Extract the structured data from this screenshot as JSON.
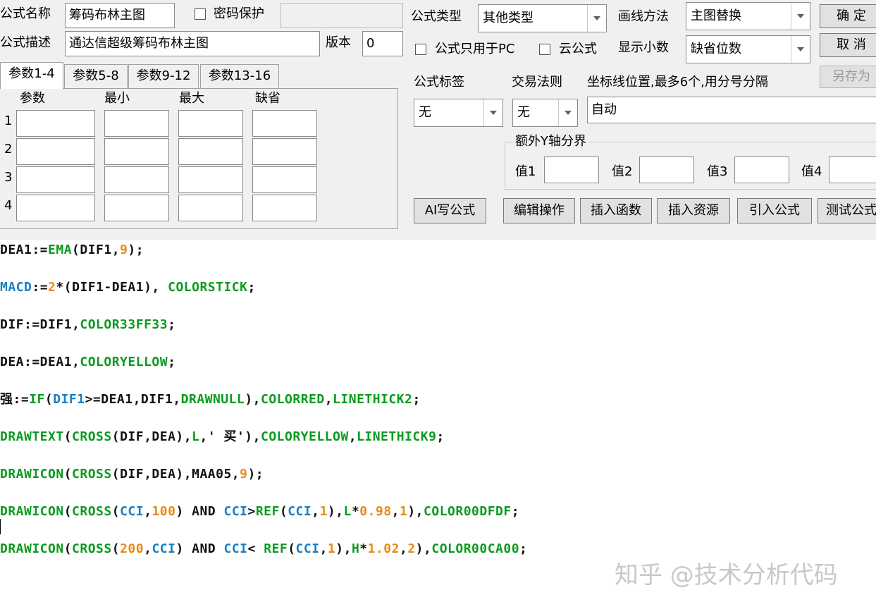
{
  "header": {
    "formula_name_label": "公式名称",
    "formula_name_value": "筹码布林主图",
    "password_label": "密码保护",
    "description_label": "公式描述",
    "description_value": "通达信超级筹码布林主图",
    "version_label": "版本",
    "version_value": "0",
    "formula_type_label": "公式类型",
    "formula_type_value": "其他类型",
    "draw_method_label": "画线方法",
    "draw_method_value": "主图替换",
    "pc_only_label": "公式只用于PC",
    "cloud_label": "云公式",
    "decimals_label": "显示小数",
    "decimals_value": "缺省位数"
  },
  "buttons": {
    "ok": "确 定",
    "cancel": "取 消",
    "save_as": "另存为",
    "ai_write": "AI写公式",
    "edit_ops": "编辑操作",
    "insert_func": "插入函数",
    "insert_res": "插入资源",
    "import_formula": "引入公式",
    "test_formula": "测试公式"
  },
  "tabs": [
    "参数1-4",
    "参数5-8",
    "参数9-12",
    "参数13-16"
  ],
  "params": {
    "headers": [
      "参数",
      "最小",
      "最大",
      "缺省"
    ],
    "rows": [
      "1",
      "2",
      "3",
      "4"
    ]
  },
  "right": {
    "tag_label": "公式标签",
    "tag_value": "无",
    "trade_label": "交易法则",
    "trade_value": "无",
    "axis_label": "坐标线位置,最多6个,用分号分隔",
    "axis_value": "自动",
    "extra_y_label": "额外Y轴分界",
    "v1": "值1",
    "v2": "值2",
    "v3": "值3",
    "v4": "值4"
  },
  "code_lines": [
    [
      [
        "DEA1:=",
        "k-d"
      ],
      [
        "EMA",
        "k-g"
      ],
      [
        "(DIF1,",
        "k-d"
      ],
      [
        "9",
        "k-o"
      ],
      [
        ");",
        "k-d"
      ]
    ],
    [
      [
        "MACD",
        "k-b"
      ],
      [
        ":=",
        "k-d"
      ],
      [
        "2",
        "k-o"
      ],
      [
        "*(DIF1-DEA1), ",
        "k-d"
      ],
      [
        "COLORSTICK",
        "k-g"
      ],
      [
        ";",
        "k-d"
      ]
    ],
    [
      [
        "DIF:=DIF1,",
        "k-d"
      ],
      [
        "COLOR33FF33",
        "k-g"
      ],
      [
        ";",
        "k-d"
      ]
    ],
    [
      [
        "DEA:=DEA1,",
        "k-d"
      ],
      [
        "COLORYELLOW",
        "k-g"
      ],
      [
        ";",
        "k-d"
      ]
    ],
    [
      [
        "强:=",
        "k-d"
      ],
      [
        "IF",
        "k-g"
      ],
      [
        "(",
        "k-d"
      ],
      [
        "DIF1",
        "k-b"
      ],
      [
        ">=DEA1,DIF1,",
        "k-d"
      ],
      [
        "DRAWNULL",
        "k-g"
      ],
      [
        "),",
        "k-d"
      ],
      [
        "COLORRED",
        "k-g"
      ],
      [
        ",",
        "k-d"
      ],
      [
        "LINETHICK2",
        "k-g"
      ],
      [
        ";",
        "k-d"
      ]
    ],
    [
      [
        "DRAWTEXT",
        "k-g"
      ],
      [
        "(",
        "k-d"
      ],
      [
        "CROSS",
        "k-g"
      ],
      [
        "(DIF,DEA),",
        "k-d"
      ],
      [
        "L",
        "k-g"
      ],
      [
        ",' 买'),",
        "k-d"
      ],
      [
        "COLORYELLOW",
        "k-g"
      ],
      [
        ",",
        "k-d"
      ],
      [
        "LINETHICK9",
        "k-g"
      ],
      [
        ";",
        "k-d"
      ]
    ],
    [
      [
        "DRAWICON",
        "k-g"
      ],
      [
        "(",
        "k-d"
      ],
      [
        "CROSS",
        "k-g"
      ],
      [
        "(DIF,DEA),MAA05,",
        "k-d"
      ],
      [
        "9",
        "k-o"
      ],
      [
        ");",
        "k-d"
      ]
    ],
    [
      [
        "DRAWICON",
        "k-g"
      ],
      [
        "(",
        "k-d"
      ],
      [
        "CROSS",
        "k-g"
      ],
      [
        "(",
        "k-d"
      ],
      [
        "CCI",
        "k-b"
      ],
      [
        ",",
        "k-d"
      ],
      [
        "100",
        "k-o"
      ],
      [
        ") AND ",
        "k-d"
      ],
      [
        "CCI",
        "k-b"
      ],
      [
        ">",
        "k-d"
      ],
      [
        "REF",
        "k-g"
      ],
      [
        "(",
        "k-d"
      ],
      [
        "CCI",
        "k-b"
      ],
      [
        ",",
        "k-d"
      ],
      [
        "1",
        "k-o"
      ],
      [
        "),",
        "k-d"
      ],
      [
        "L",
        "k-g"
      ],
      [
        "*",
        "k-d"
      ],
      [
        "0.98",
        "k-o"
      ],
      [
        ",",
        "k-d"
      ],
      [
        "1",
        "k-o"
      ],
      [
        "),",
        "k-d"
      ],
      [
        "COLOR00DFDF",
        "k-g"
      ],
      [
        ";",
        "k-d"
      ]
    ],
    [
      [
        "DRAWICON",
        "k-g"
      ],
      [
        "(",
        "k-d"
      ],
      [
        "CROSS",
        "k-g"
      ],
      [
        "(",
        "k-d"
      ],
      [
        "200",
        "k-o"
      ],
      [
        ",",
        "k-d"
      ],
      [
        "CCI",
        "k-b"
      ],
      [
        ") AND ",
        "k-d"
      ],
      [
        "CCI",
        "k-b"
      ],
      [
        "< ",
        "k-d"
      ],
      [
        "REF",
        "k-g"
      ],
      [
        "(",
        "k-d"
      ],
      [
        "CCI",
        "k-b"
      ],
      [
        ",",
        "k-d"
      ],
      [
        "1",
        "k-o"
      ],
      [
        "),",
        "k-d"
      ],
      [
        "H",
        "k-g"
      ],
      [
        "*",
        "k-d"
      ],
      [
        "1.02",
        "k-o"
      ],
      [
        ",",
        "k-d"
      ],
      [
        "2",
        "k-o"
      ],
      [
        "),",
        "k-d"
      ],
      [
        "COLOR00CA00",
        "k-g"
      ],
      [
        ";",
        "k-d"
      ]
    ]
  ],
  "watermark": "知乎 @技术分析代码"
}
